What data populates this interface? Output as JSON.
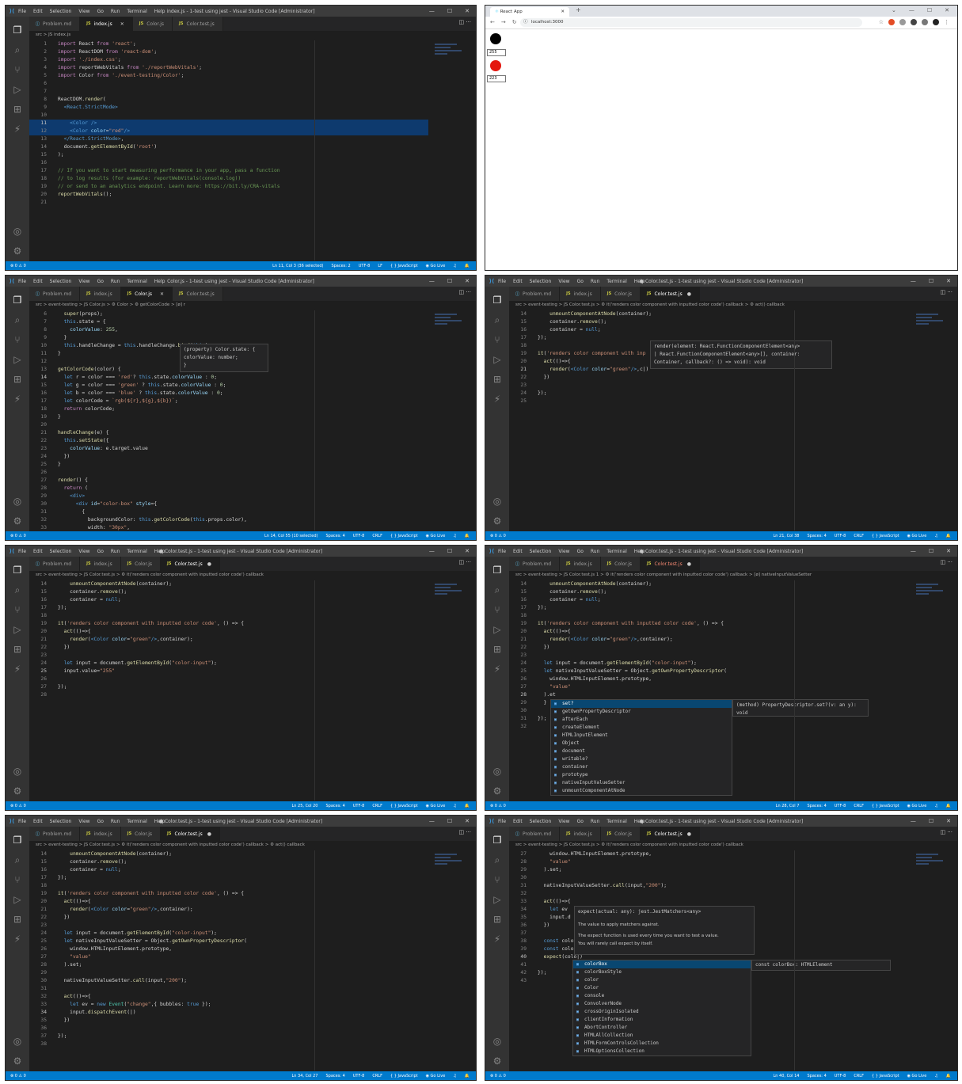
{
  "menu": [
    "File",
    "Edit",
    "Selection",
    "View",
    "Go",
    "Run",
    "Terminal",
    "Help"
  ],
  "window_controls": [
    "—",
    "☐",
    "✕"
  ],
  "tabs": {
    "problem": "Problem.md",
    "index": "index.js",
    "color": "Color.js",
    "colortest": "Color.test.js"
  },
  "panel1": {
    "title": "index.js - 1-test using jest - Visual Studio Code [Administrator]",
    "breadcrumb": "src > JS index.js",
    "lines": [
      [
        "1",
        "<span class='p2'>import</span> React <span class='p2'>from</span> <span class='s2'>'react'</span>;"
      ],
      [
        "2",
        "<span class='p2'>import</span> ReactDOM <span class='p2'>from</span> <span class='s2'>'react-dom'</span>;"
      ],
      [
        "3",
        "<span class='p2'>import</span> <span class='s2'>'./index.css'</span>;"
      ],
      [
        "4",
        "<span class='p2'>import</span> reportWebVitals <span class='p2'>from</span> <span class='s2'>'./reportWebVitals'</span>;"
      ],
      [
        "5",
        "<span class='p2'>import</span> Color <span class='p2'>from</span> <span class='s2'>'./event-testing/Color'</span>;"
      ],
      [
        "6",
        ""
      ],
      [
        "7",
        ""
      ],
      [
        "8",
        "ReactDOM.<span class='f2'>render</span>("
      ],
      [
        "9",
        "  <span class='tg'>&lt;React.StrictMode&gt;</span>"
      ],
      [
        "10",
        ""
      ],
      [
        "11",
        "    <span class='tg'>&lt;Color /&gt;</span>"
      ],
      [
        "12",
        "    <span class='tg'>&lt;Color</span> <span class='at'>color</span>=<span class='s2'>\"red\"</span><span class='tg'>/&gt;</span>"
      ],
      [
        "13",
        "  <span class='tg'>&lt;/React.StrictMode&gt;</span>,"
      ],
      [
        "14",
        "  document.<span class='f2'>getElementById</span>(<span class='s2'>'root'</span>)"
      ],
      [
        "15",
        ");"
      ],
      [
        "16",
        ""
      ],
      [
        "17",
        "<span class='cm'>// If you want to start measuring performance in your app, pass a function</span>"
      ],
      [
        "18",
        "<span class='cm'>// to log results (for example: reportWebVitals(console.log))</span>"
      ],
      [
        "19",
        "<span class='cm'>// or send to an analytics endpoint. Learn more: https://bit.ly/CRA-vitals</span>"
      ],
      [
        "20",
        "<span class='f2'>reportWebVitals</span>();"
      ],
      [
        "21",
        ""
      ]
    ],
    "status_left": "⊗ 0 ⚠ 0",
    "status_right": [
      "Ln 11, Col 3 (36 selected)",
      "Spaces: 2",
      "UTF-8",
      "LF",
      "{ } JavaScript",
      "◉ Go Live",
      "♫",
      "🔔"
    ]
  },
  "panel2": {
    "tab_title": "React App",
    "url": "localhost:3000",
    "input1": "255",
    "input2": "223"
  },
  "panel3": {
    "title": "Color.js - 1-test using jest - Visual Studio Code [Administrator]",
    "breadcrumb": "src > event-testing > JS Color.js > ⚙ Color > ⚙ getColorCode > [ø] r",
    "lines": [
      [
        "6",
        "  <span class='f2'>super</span>(props);"
      ],
      [
        "7",
        "  <span class='k2'>this</span>.state = {"
      ],
      [
        "8",
        "    <span class='v2'>colorValue</span>: <span class='num'>255</span>,"
      ],
      [
        "9",
        "  }"
      ],
      [
        "10",
        "  <span class='k2'>this</span>.handleChange = <span class='k2'>this</span>.handleChange.<span class='f2'>bind</span>(<span class='k2'>this</span>);"
      ],
      [
        "11",
        "}"
      ],
      [
        "12",
        ""
      ],
      [
        "13",
        "<span class='f2'>getColorCode</span>(color) {"
      ],
      [
        "14",
        "  <span class='k2'>let</span> r = color === <span class='s2'>'red'</span>? <span class='k2'>this</span>.state.<span class='v2'>colorValue</span> : <span class='num'>0</span>;"
      ],
      [
        "15",
        "  <span class='k2'>let</span> g = color === <span class='s2'>'green'</span> ? <span class='k2'>this</span>.state.<span class='v2'>colorValue</span> : <span class='num'>0</span>;"
      ],
      [
        "16",
        "  <span class='k2'>let</span> b = color === <span class='s2'>'blue'</span> ? <span class='k2'>this</span>.state.<span class='v2'>colorValue</span> : <span class='num'>0</span>;"
      ],
      [
        "17",
        "  <span class='k2'>let</span> colorCode = <span class='s2'>`rgb(${r},${g},${b})`</span>;"
      ],
      [
        "18",
        "  <span class='p2'>return</span> colorCode;"
      ],
      [
        "19",
        "}"
      ],
      [
        "20",
        ""
      ],
      [
        "21",
        "<span class='f2'>handleChange</span>(e) {"
      ],
      [
        "22",
        "  <span class='k2'>this</span>.<span class='f2'>setState</span>({"
      ],
      [
        "23",
        "    <span class='v2'>colorValue</span>: e.target.value"
      ],
      [
        "24",
        "  })"
      ],
      [
        "25",
        "}"
      ],
      [
        "26",
        ""
      ],
      [
        "27",
        "<span class='f2'>render</span>() {"
      ],
      [
        "28",
        "  <span class='p2'>return</span> ("
      ],
      [
        "29",
        "    <span class='tg'>&lt;div&gt;</span>"
      ],
      [
        "30",
        "      <span class='tg'>&lt;div</span> <span class='at'>id</span>=<span class='s2'>\"color-box\"</span> <span class='at'>style</span>={"
      ],
      [
        "31",
        "        {"
      ],
      [
        "32",
        "          backgroundColor: <span class='k2'>this</span>.<span class='f2'>getColorCode</span>(<span class='k2'>this</span>.props.color),"
      ],
      [
        "33",
        "          width: <span class='s2'>\"30px\"</span>,"
      ]
    ],
    "hover": [
      "(property) Color.state: {",
      "    colorValue: number;",
      "}"
    ],
    "status_right": [
      "Ln 14, Col 55 (10 selected)",
      "Spaces: 4",
      "UTF-8",
      "CRLF",
      "{ } JavaScript",
      "◉ Go Live",
      "♫",
      "🔔"
    ]
  },
  "panel4": {
    "title": "● Color.test.js - 1-test using jest - Visual Studio Code [Administrator]",
    "breadcrumb": "src > event-testing > JS Color.test.js > ⚙ it('renders color component with inputted color code') callback > ⚙ act() callback",
    "lines": [
      [
        "14",
        "    <span class='f2'>unmountComponentAtNode</span>(container);"
      ],
      [
        "15",
        "    container.<span class='f2'>remove</span>();"
      ],
      [
        "16",
        "    container = <span class='k2'>null</span>;"
      ],
      [
        "17",
        "});"
      ],
      [
        "18",
        ""
      ],
      [
        "19",
        "<span class='f2'>it</span>(<span class='s2'>'renders color component with inp</span>"
      ],
      [
        "20",
        "  <span class='f2'>act</span>(()=>{"
      ],
      [
        "21",
        "    <span class='f2'>render</span>(<span class='tg'>&lt;Color</span> <span class='at'>color</span>=<span class='s2'>\"green\"</span><span class='tg'>/&gt;</span>,c|)"
      ],
      [
        "22",
        "  })"
      ],
      [
        "23",
        ""
      ],
      [
        "24",
        "});"
      ],
      [
        "25",
        ""
      ]
    ],
    "hover": [
      "render(element: React.FunctionComponentElement<any>",
      "| React.FunctionComponentElement<any>[], container:",
      "Container, callback?: () => void): void"
    ],
    "status_right": [
      "Ln 21, Col 38",
      "Spaces: 4",
      "UTF-8",
      "CRLF",
      "{ } JavaScript",
      "◉ Go Live",
      "♫",
      "🔔"
    ]
  },
  "panel5": {
    "title": "● Color.test.js - 1-test using jest - Visual Studio Code [Administrator]",
    "breadcrumb": "src > event-testing > JS Color.test.js > ⚙ it('renders color component with inputted color code') callback",
    "lines": [
      [
        "14",
        "    <span class='f2'>unmountComponentAtNode</span>(container);"
      ],
      [
        "15",
        "    container.<span class='f2'>remove</span>();"
      ],
      [
        "16",
        "    container = <span class='k2'>null</span>;"
      ],
      [
        "17",
        "});"
      ],
      [
        "18",
        ""
      ],
      [
        "19",
        "<span class='f2'>it</span>(<span class='s2'>'renders color component with inputted color code'</span>, () => {"
      ],
      [
        "20",
        "  <span class='f2'>act</span>(()=>{"
      ],
      [
        "21",
        "    <span class='f2'>render</span>(<span class='tg'>&lt;Color</span> <span class='at'>color</span>=<span class='s2'>\"green\"</span><span class='tg'>/&gt;</span>,container);"
      ],
      [
        "22",
        "  })"
      ],
      [
        "23",
        ""
      ],
      [
        "24",
        "  <span class='k2'>let</span> input = document.<span class='f2'>getElementById</span>(<span class='s2'>\"color-input\"</span>);"
      ],
      [
        "25",
        "  input.value=<span class='s2'>\"255\"</span>"
      ],
      [
        "26",
        ""
      ],
      [
        "27",
        "});"
      ],
      [
        "28",
        ""
      ]
    ],
    "status_right": [
      "Ln 25, Col 20",
      "Spaces: 4",
      "UTF-8",
      "CRLF",
      "{ } JavaScript",
      "◉ Go Live",
      "♫",
      "🔔"
    ]
  },
  "panel6": {
    "title": "● Color.test.js - 1-test using jest - Visual Studio Code [Administrator]",
    "breadcrumb": "src > event-testing > JS Color.test.js 1 > ⚙ it('renders color component with inputted color code') callback > [ø] nativeInputValueSetter",
    "lines": [
      [
        "14",
        "    <span class='f2'>unmountComponentAtNode</span>(container);"
      ],
      [
        "15",
        "    container.<span class='f2'>remove</span>();"
      ],
      [
        "16",
        "    container = <span class='k2'>null</span>;"
      ],
      [
        "17",
        "});"
      ],
      [
        "18",
        ""
      ],
      [
        "19",
        "<span class='f2'>it</span>(<span class='s2'>'renders color component with inputted color code'</span>, () => {"
      ],
      [
        "20",
        "  <span class='f2'>act</span>(()=>{"
      ],
      [
        "21",
        "    <span class='f2'>render</span>(<span class='tg'>&lt;Color</span> <span class='at'>color</span>=<span class='s2'>\"green\"</span><span class='tg'>/&gt;</span>,container);"
      ],
      [
        "22",
        "  })"
      ],
      [
        "23",
        ""
      ],
      [
        "24",
        "  <span class='k2'>let</span> input = document.<span class='f2'>getElementById</span>(<span class='s2'>\"color-input\"</span>);"
      ],
      [
        "25",
        "  <span class='k2'>let</span> nativeInputValueSetter = Object.<span class='f2'>getOwnPropertyDescriptor</span>("
      ],
      [
        "26",
        "    window.HTMLInputElement.prototype,"
      ],
      [
        "27",
        "    <span class='s2'>\"value\"</span>"
      ],
      [
        "28",
        "  ).et"
      ],
      [
        "29",
        "  }"
      ],
      [
        "30",
        ""
      ],
      [
        "31",
        "});"
      ],
      [
        "32",
        ""
      ]
    ],
    "suggest": [
      "set?",
      "getOwnPropertyDescriptor",
      "afterEach",
      "createElement",
      "HTMLInputElement",
      "Object",
      "document",
      "writable?",
      "container",
      "prototype",
      "nativeInputValueSetter",
      "unmountComponentAtNode"
    ],
    "suggest_detail": "(method) PropertyDescriptor.set?(v: an y): void",
    "status_right": [
      "Ln 28, Col 7",
      "Spaces: 4",
      "UTF-8",
      "CRLF",
      "{ } JavaScript",
      "◉ Go Live",
      "♫",
      "🔔"
    ]
  },
  "panel7": {
    "title": "● Color.test.js - 1-test using jest - Visual Studio Code [Administrator]",
    "breadcrumb": "src > event-testing > JS Color.test.js > ⚙ it('renders color component with inputted color code') callback > ⚙ act() callback",
    "lines": [
      [
        "14",
        "    <span class='f2'>unmountComponentAtNode</span>(container);"
      ],
      [
        "15",
        "    container.<span class='f2'>remove</span>();"
      ],
      [
        "16",
        "    container = <span class='k2'>null</span>;"
      ],
      [
        "17",
        "});"
      ],
      [
        "18",
        ""
      ],
      [
        "19",
        "<span class='f2'>it</span>(<span class='s2'>'renders color component with inputted color code'</span>, () => {"
      ],
      [
        "20",
        "  <span class='f2'>act</span>(()=>{"
      ],
      [
        "21",
        "    <span class='f2'>render</span>(<span class='tg'>&lt;Color</span> <span class='at'>color</span>=<span class='s2'>\"green\"</span><span class='tg'>/&gt;</span>,container);"
      ],
      [
        "22",
        "  })"
      ],
      [
        "23",
        ""
      ],
      [
        "24",
        "  <span class='k2'>let</span> input = document.<span class='f2'>getElementById</span>(<span class='s2'>\"color-input\"</span>);"
      ],
      [
        "25",
        "  <span class='k2'>let</span> nativeInputValueSetter = Object.<span class='f2'>getOwnPropertyDescriptor</span>("
      ],
      [
        "26",
        "    window.HTMLInputElement.prototype,"
      ],
      [
        "27",
        "    <span class='s2'>\"value\"</span>"
      ],
      [
        "28",
        "  ).set;"
      ],
      [
        "29",
        ""
      ],
      [
        "30",
        "  nativeInputValueSetter.<span class='f2'>call</span>(input,<span class='s2'>\"200\"</span>);"
      ],
      [
        "31",
        ""
      ],
      [
        "32",
        "  <span class='f2'>act</span>(()=>{"
      ],
      [
        "33",
        "    <span class='k2'>let</span> ev = <span class='k2'>new</span> <span class='t2'>Event</span>(<span class='s2'>\"change\"</span>,{ bubbles: <span class='k2'>true</span> });"
      ],
      [
        "34",
        "    input.<span class='f2'>dispatchEvent</span>(|)"
      ],
      [
        "35",
        "  })"
      ],
      [
        "36",
        ""
      ],
      [
        "37",
        "});"
      ],
      [
        "38",
        ""
      ]
    ],
    "status_right": [
      "Ln 34, Col 27",
      "Spaces: 4",
      "UTF-8",
      "CRLF",
      "{ } JavaScript",
      "◉ Go Live",
      "♫",
      "🔔"
    ]
  },
  "panel8": {
    "title": "● Color.test.js - 1-test using jest - Visual Studio Code [Administrator]",
    "breadcrumb": "src > event-testing > JS Color.test.js > ⚙ it('renders color component with inputted color code') callback",
    "lines": [
      [
        "27",
        "    window.HTMLInputElement.prototype,"
      ],
      [
        "28",
        "    <span class='s2'>\"value\"</span>"
      ],
      [
        "29",
        "  ).set;"
      ],
      [
        "30",
        ""
      ],
      [
        "31",
        "  nativeInputValueSetter.<span class='f2'>call</span>(input,<span class='s2'>\"200\"</span>);"
      ],
      [
        "32",
        ""
      ],
      [
        "33",
        "  <span class='f2'>act</span>(()=>{"
      ],
      [
        "34",
        "    <span class='k2'>let</span> ev"
      ],
      [
        "35",
        "    input.d"
      ],
      [
        "36",
        "  })"
      ],
      [
        "37",
        ""
      ],
      [
        "38",
        "  <span class='k2'>const</span> color"
      ],
      [
        "39",
        "  <span class='k2'>const</span> color"
      ],
      [
        "40",
        "  <span class='f2'>expect</span>(colo|)"
      ],
      [
        "41",
        ""
      ],
      [
        "42",
        "});"
      ],
      [
        "43",
        ""
      ]
    ],
    "hover_sig": "expect(actual: any): jest.JestMatchers<any>",
    "hover_l1": "The value to apply matchers against.",
    "hover_l2": "The  expect  function is used every time you want to test a value.",
    "hover_l3": "You will rarely call  expect  by itself.",
    "suggest": [
      "colorBox",
      "colorBoxStyle",
      "color",
      "Color",
      "console",
      "ConvolverNode",
      "crossOriginIsolated",
      "clientInformation",
      "AbortController",
      "HTMLAllCollection",
      "HTMLFormControlsCollection",
      "HTMLOptionsCollection"
    ],
    "suggest_detail": "const colorBox: HTMLElement",
    "status_right": [
      "Ln 40, Col 14",
      "Spaces: 4",
      "UTF-8",
      "CRLF",
      "{ } JavaScript",
      "◉ Go Live",
      "♫",
      "🔔"
    ]
  }
}
